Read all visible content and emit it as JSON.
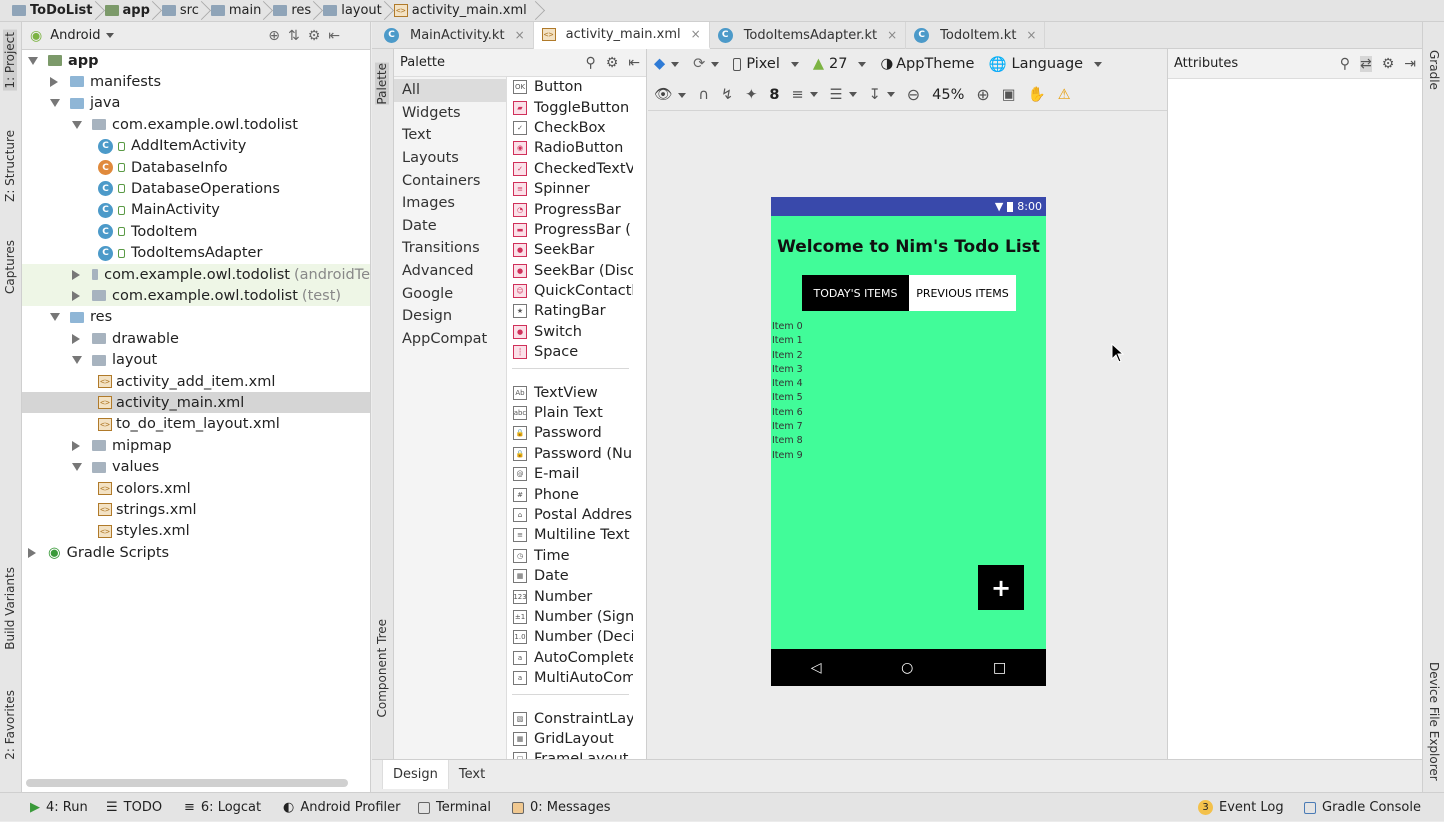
{
  "breadcrumb": [
    "ToDoList",
    "app",
    "src",
    "main",
    "res",
    "layout",
    "activity_main.xml"
  ],
  "left_strip": {
    "project": "1: Project",
    "structure": "Z: Structure",
    "captures": "Captures",
    "build_variants": "Build Variants",
    "favorites": "2: Favorites"
  },
  "right_strip": {
    "gradle": "Gradle",
    "device_explorer": "Device File Explorer"
  },
  "project_panel": {
    "view_mode": "Android",
    "tree": [
      {
        "label": "app",
        "kind": "module",
        "expanded": true,
        "bold": true
      },
      {
        "label": "manifests",
        "kind": "folder",
        "expanded": false
      },
      {
        "label": "java",
        "kind": "folder",
        "expanded": true
      },
      {
        "label": "com.example.owl.todolist",
        "kind": "package",
        "expanded": true
      },
      {
        "label": "AddItemActivity",
        "kind": "class"
      },
      {
        "label": "DatabaseInfo",
        "kind": "class"
      },
      {
        "label": "DatabaseOperations",
        "kind": "class"
      },
      {
        "label": "MainActivity",
        "kind": "class"
      },
      {
        "label": "TodoItem",
        "kind": "class"
      },
      {
        "label": "TodoItemsAdapter",
        "kind": "class"
      },
      {
        "label": "com.example.owl.todolist",
        "suffix": "(androidTe",
        "kind": "package",
        "expanded": false
      },
      {
        "label": "com.example.owl.todolist",
        "suffix": "(test)",
        "kind": "package",
        "expanded": false
      },
      {
        "label": "res",
        "kind": "folder",
        "expanded": true
      },
      {
        "label": "drawable",
        "kind": "package",
        "expanded": false
      },
      {
        "label": "layout",
        "kind": "package",
        "expanded": true
      },
      {
        "label": "activity_add_item.xml",
        "kind": "xml"
      },
      {
        "label": "activity_main.xml",
        "kind": "xml",
        "selected": true
      },
      {
        "label": "to_do_item_layout.xml",
        "kind": "xml"
      },
      {
        "label": "mipmap",
        "kind": "package",
        "expanded": false
      },
      {
        "label": "values",
        "kind": "package",
        "expanded": true
      },
      {
        "label": "colors.xml",
        "kind": "xml"
      },
      {
        "label": "strings.xml",
        "kind": "xml"
      },
      {
        "label": "styles.xml",
        "kind": "xml"
      },
      {
        "label": "Gradle Scripts",
        "kind": "gradle",
        "expanded": false
      }
    ]
  },
  "tabs": [
    {
      "label": "MainActivity.kt",
      "active": false
    },
    {
      "label": "activity_main.xml",
      "active": true
    },
    {
      "label": "TodoItemsAdapter.kt",
      "active": false
    },
    {
      "label": "TodoItem.kt",
      "active": false
    }
  ],
  "palette": {
    "title": "Palette",
    "side_label": "Palette",
    "component_tree_label": "Component Tree",
    "categories": [
      "All",
      "Widgets",
      "Text",
      "Layouts",
      "Containers",
      "Images",
      "Date",
      "Transitions",
      "Advanced",
      "Google",
      "Design",
      "AppCompat"
    ],
    "selected_category": "All",
    "groups": [
      [
        {
          "icon": "OK",
          "label": "Button"
        },
        {
          "icon": "toggle-icon",
          "label": "ToggleButton"
        },
        {
          "icon": "check-icon",
          "label": "CheckBox"
        },
        {
          "icon": "radio-icon",
          "label": "RadioButton"
        },
        {
          "icon": "checked-text-icon",
          "label": "CheckedTextV"
        },
        {
          "icon": "spinner-icon",
          "label": "Spinner"
        },
        {
          "icon": "progress-circle-icon",
          "label": "ProgressBar"
        },
        {
          "icon": "progress-bar-icon",
          "label": "ProgressBar ("
        },
        {
          "icon": "seekbar-icon",
          "label": "SeekBar"
        },
        {
          "icon": "seekbar-discrete-icon",
          "label": "SeekBar (Disc"
        },
        {
          "icon": "contact-icon",
          "label": "QuickContactl"
        },
        {
          "icon": "star-icon",
          "label": "RatingBar"
        },
        {
          "icon": "switch-icon",
          "label": "Switch"
        },
        {
          "icon": "space-icon",
          "label": "Space"
        }
      ],
      [
        {
          "icon": "Ab",
          "label": "TextView"
        },
        {
          "icon": "abc",
          "label": "Plain Text"
        },
        {
          "icon": "lock-icon",
          "label": "Password"
        },
        {
          "icon": "lock-num-icon",
          "label": "Password (Nu"
        },
        {
          "icon": "@",
          "label": "E-mail"
        },
        {
          "icon": "#",
          "label": "Phone"
        },
        {
          "icon": "home-icon",
          "label": "Postal Addres"
        },
        {
          "icon": "multiline-icon",
          "label": "Multiline Text"
        },
        {
          "icon": "clock-icon",
          "label": "Time"
        },
        {
          "icon": "calendar-icon",
          "label": "Date"
        },
        {
          "icon": "123",
          "label": "Number"
        },
        {
          "icon": "±1",
          "label": "Number (Signe"
        },
        {
          "icon": "1.0",
          "label": "Number (Deci"
        },
        {
          "icon": "a",
          "label": "AutoComplete"
        },
        {
          "icon": "a",
          "label": "MultiAutoCom"
        }
      ],
      [
        {
          "icon": "constraint-icon",
          "label": "ConstraintLay"
        },
        {
          "icon": "grid-icon",
          "label": "GridLayout"
        },
        {
          "icon": "frame-icon",
          "label": "FrameLayout"
        }
      ]
    ]
  },
  "design_toolbar": {
    "device": "Pixel",
    "api": "27",
    "theme": "AppTheme",
    "language": "Language",
    "margin": "8",
    "zoom": "45%"
  },
  "phone": {
    "status_time": "8:00",
    "title": "Welcome to Nim's Todo List",
    "segment_left": "TODAY'S ITEMS",
    "segment_right": "PREVIOUS ITEMS",
    "items": [
      "Item 0",
      "Item 1",
      "Item 2",
      "Item 3",
      "Item 4",
      "Item 5",
      "Item 6",
      "Item 7",
      "Item 8",
      "Item 9"
    ],
    "fab_symbol": "+",
    "background_color": "#41fc99",
    "status_color": "#3949ab"
  },
  "attributes": {
    "title": "Attributes"
  },
  "design_tabs": [
    {
      "label": "Design",
      "active": true
    },
    {
      "label": "Text",
      "active": false
    }
  ],
  "bottom_bar": {
    "run": "4: Run",
    "todo": "TODO",
    "logcat": "6: Logcat",
    "profiler": "Android Profiler",
    "terminal": "Terminal",
    "messages": "0: Messages",
    "event_count": "3",
    "event_log": "Event Log",
    "gradle_console": "Gradle Console"
  }
}
